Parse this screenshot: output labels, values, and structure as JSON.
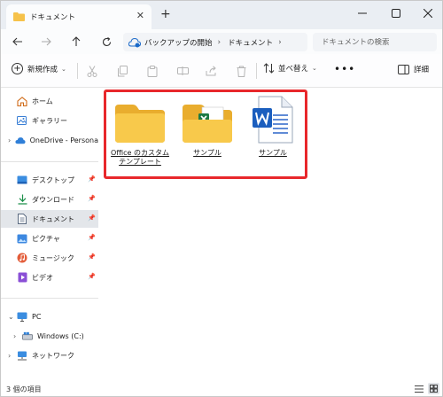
{
  "tab": {
    "title": "ドキュメント"
  },
  "address": {
    "crumbs": [
      "バックアップの開始",
      "ドキュメント"
    ],
    "search_placeholder": "ドキュメントの検索"
  },
  "toolbar": {
    "new_label": "新規作成",
    "sort_label": "並べ替え",
    "details_label": "詳細"
  },
  "sidebar": {
    "quick": [
      {
        "label": "ホーム"
      },
      {
        "label": "ギャラリー"
      },
      {
        "label": "OneDrive - Persona"
      }
    ],
    "pinned": [
      {
        "label": "デスクトップ"
      },
      {
        "label": "ダウンロード"
      },
      {
        "label": "ドキュメント"
      },
      {
        "label": "ピクチャ"
      },
      {
        "label": "ミュージック"
      },
      {
        "label": "ビデオ"
      }
    ],
    "pc": {
      "label": "PC"
    },
    "drive": {
      "label": "Windows (C:)"
    },
    "network": {
      "label": "ネットワーク"
    }
  },
  "files": [
    {
      "name": "Office のカスタム テンプレート",
      "kind": "folder"
    },
    {
      "name": "サンプル",
      "kind": "folder-with-excel"
    },
    {
      "name": "サンプル",
      "kind": "word-document"
    }
  ],
  "status": {
    "count_text": "3 個の項目"
  },
  "colors": {
    "highlight": "#e8272b",
    "folder": "#f8c74a",
    "word_blue": "#1b5ebe",
    "excel_green": "#1d7a44"
  }
}
